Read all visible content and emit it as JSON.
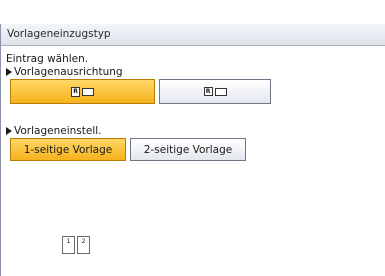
{
  "window": {
    "title": "Vorlageneinzugstyp"
  },
  "instruction": "Eintrag wählen.",
  "orientation": {
    "label": "Vorlagenausrichtung",
    "options": [
      {
        "icon": "portrait-orientation-icon",
        "selected": true
      },
      {
        "icon": "landscape-orientation-icon",
        "selected": false
      }
    ]
  },
  "setting": {
    "label": "Vorlageneinstell.",
    "options": [
      {
        "label": "1-seitige Vorlage",
        "selected": true
      },
      {
        "label": "2-seitige Vorlage",
        "selected": false
      }
    ]
  },
  "preview": {
    "pages": [
      "1",
      "2"
    ]
  },
  "colors": {
    "selected": "#f6b21c",
    "border": "#6f7785"
  }
}
